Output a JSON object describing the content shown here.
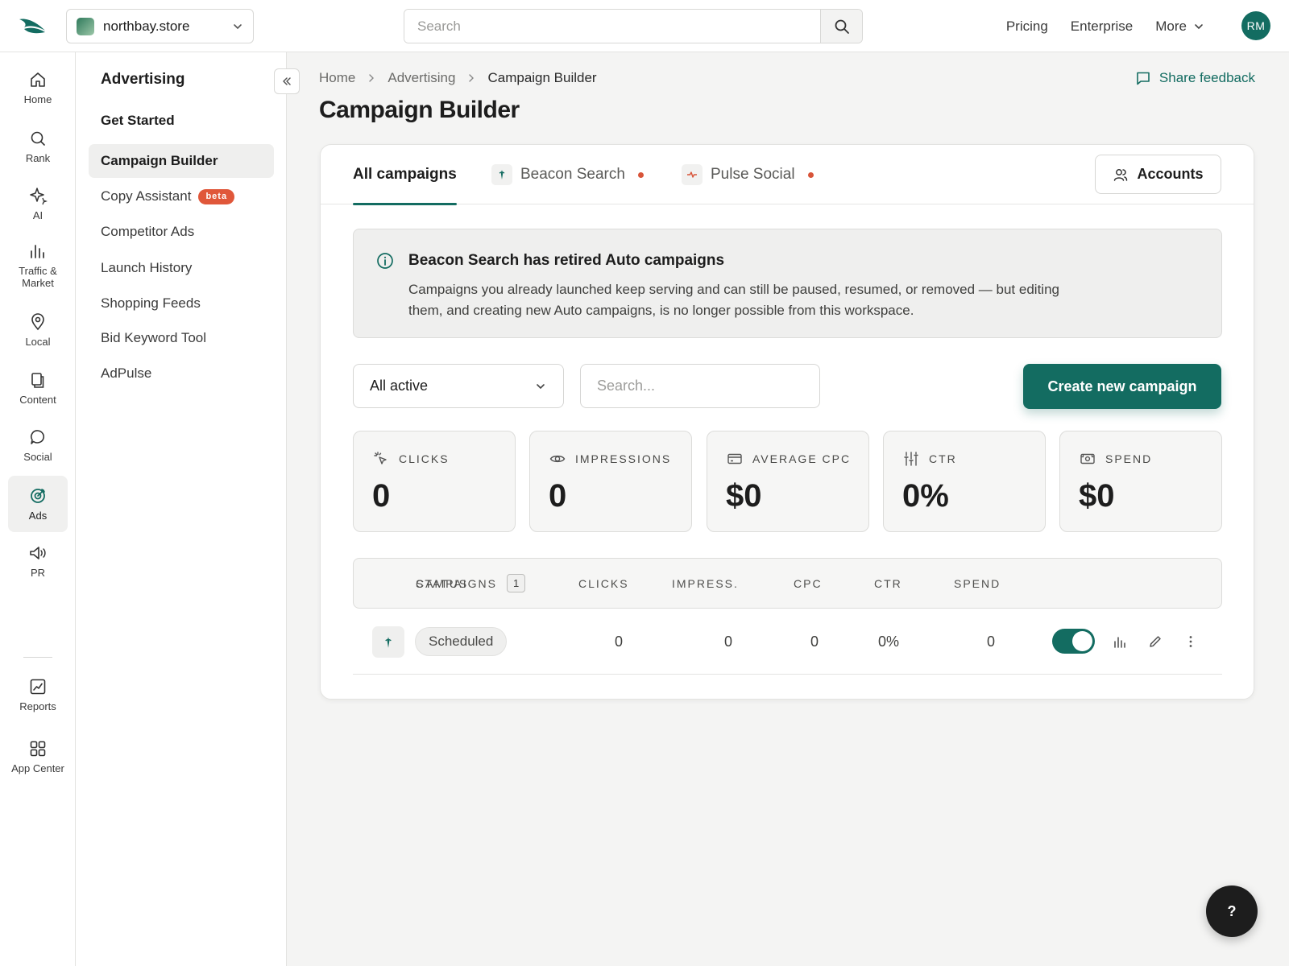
{
  "topbar": {
    "site_name": "northbay.store",
    "search_placeholder": "Search",
    "nav": [
      "Pricing",
      "Enterprise",
      "More"
    ],
    "avatar_initials": "RM"
  },
  "rail": {
    "items": [
      {
        "label": "Home",
        "icon": "home-icon"
      },
      {
        "label": "Rank",
        "icon": "search-icon"
      },
      {
        "label": "AI",
        "icon": "sparkle-icon"
      },
      {
        "label": "Traffic & Market",
        "icon": "bar-chart-icon"
      },
      {
        "label": "Local",
        "icon": "map-pin-icon"
      },
      {
        "label": "Content",
        "icon": "documents-icon"
      },
      {
        "label": "Social",
        "icon": "chat-bubble-icon"
      },
      {
        "label": "Ads",
        "icon": "target-icon"
      },
      {
        "label": "PR",
        "icon": "megaphone-icon"
      },
      {
        "label": "Reports",
        "icon": "trend-chart-icon"
      },
      {
        "label": "App Center",
        "icon": "grid-icon"
      }
    ],
    "active": "Ads"
  },
  "subnav": {
    "title": "Advertising",
    "items": [
      {
        "label": "Get Started"
      },
      {
        "label": "Campaign Builder"
      },
      {
        "label": "Copy Assistant",
        "badge": "beta"
      },
      {
        "label": "Competitor Ads"
      },
      {
        "label": "Launch History"
      },
      {
        "label": "Shopping Feeds"
      },
      {
        "label": "Bid Keyword Tool"
      },
      {
        "label": "AdPulse"
      }
    ],
    "active": "Campaign Builder"
  },
  "breadcrumb": [
    "Home",
    "Advertising",
    "Campaign Builder"
  ],
  "share_feedback": "Share feedback",
  "page_title": "Campaign Builder",
  "tabs": [
    {
      "label": "All campaigns",
      "active": true
    },
    {
      "label": "Beacon Search",
      "icon": "beacon-icon",
      "dot": true
    },
    {
      "label": "Pulse Social",
      "icon": "pulse-icon",
      "dot": true
    }
  ],
  "accounts_button": "Accounts",
  "notice": {
    "title": "Beacon Search has retired Auto campaigns",
    "body": "Campaigns you already launched keep serving and can still be paused, resumed, or removed — but editing them, and creating new Auto campaigns, is no longer possible from this workspace."
  },
  "filters": {
    "status_selected": "All active",
    "search_placeholder": "Search...",
    "create_button": "Create new campaign"
  },
  "stats": [
    {
      "label": "CLICKS",
      "value": "0",
      "icon": "cursor-click-icon"
    },
    {
      "label": "IMPRESSIONS",
      "value": "0",
      "icon": "eye-icon"
    },
    {
      "label": "AVERAGE CPC",
      "value": "$0",
      "icon": "credit-card-icon"
    },
    {
      "label": "CTR",
      "value": "0%",
      "icon": "sliders-icon"
    },
    {
      "label": "SPEND",
      "value": "$0",
      "icon": "cash-icon"
    }
  ],
  "table": {
    "header_campaigns": "CAMPAIGNS",
    "header_status": "STATUS",
    "campaign_count": "1",
    "columns": [
      "CLICKS",
      "IMPRESS.",
      "CPC",
      "CTR",
      "SPEND"
    ],
    "rows": [
      {
        "platform": "beacon-icon",
        "status": "Scheduled",
        "clicks": "0",
        "impressions": "0",
        "cpc": "0",
        "ctr": "0%",
        "spend": "0",
        "enabled": true
      }
    ]
  },
  "help_button": "?",
  "colors": {
    "accent": "#136c61",
    "alert_dot": "#d8553a",
    "beta_badge": "#e0573a"
  }
}
